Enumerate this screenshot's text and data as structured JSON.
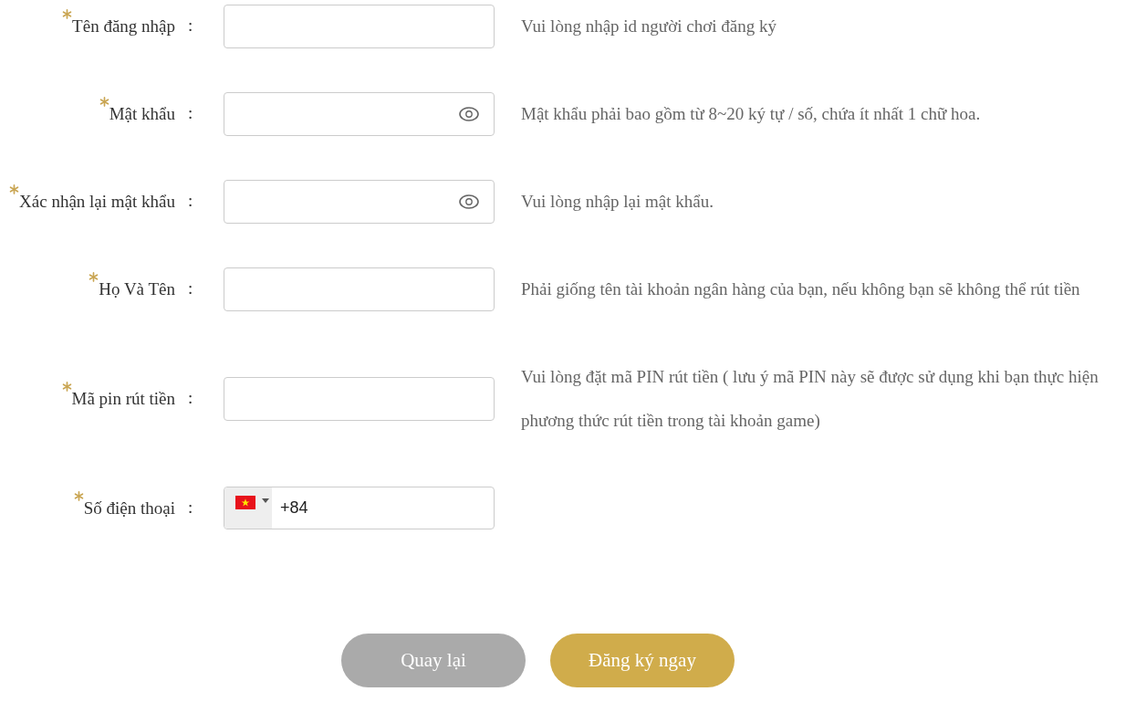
{
  "form": {
    "fields": [
      {
        "kind": "text",
        "required": true,
        "label": "Tên đăng nhập",
        "separator": ":",
        "hint": "Vui lòng nhập id người chơi đăng ký"
      },
      {
        "kind": "password",
        "required": true,
        "label": "Mật khẩu",
        "separator": ":",
        "hint": "Mật khẩu phải bao gồm từ 8~20 ký tự / số, chứa ít nhất 1 chữ hoa."
      },
      {
        "kind": "password",
        "required": true,
        "label": "Xác nhận lại mật khẩu",
        "separator": ":",
        "hint": "Vui lòng nhập lại mật khẩu."
      },
      {
        "kind": "text",
        "required": true,
        "label": "Họ Và Tên",
        "separator": ":",
        "hint": "Phải giống tên tài khoản ngân hàng của bạn, nếu không bạn sẽ không thể rút tiền"
      },
      {
        "kind": "text",
        "required": true,
        "label": "Mã pin rút tiền",
        "separator": ":",
        "hint": "Vui lòng đặt mã PIN rút tiền ( lưu ý mã PIN này sẽ được sử dụng khi bạn thực hiện phương thức rút tiền trong tài khoản game)"
      },
      {
        "kind": "phone",
        "required": true,
        "label": "Số điện thoại",
        "separator": ":",
        "value": "+84"
      }
    ]
  },
  "buttons": [
    {
      "kind": "secondary",
      "label": "Quay lại"
    },
    {
      "kind": "primary",
      "label": "Đăng ký ngay"
    }
  ]
}
